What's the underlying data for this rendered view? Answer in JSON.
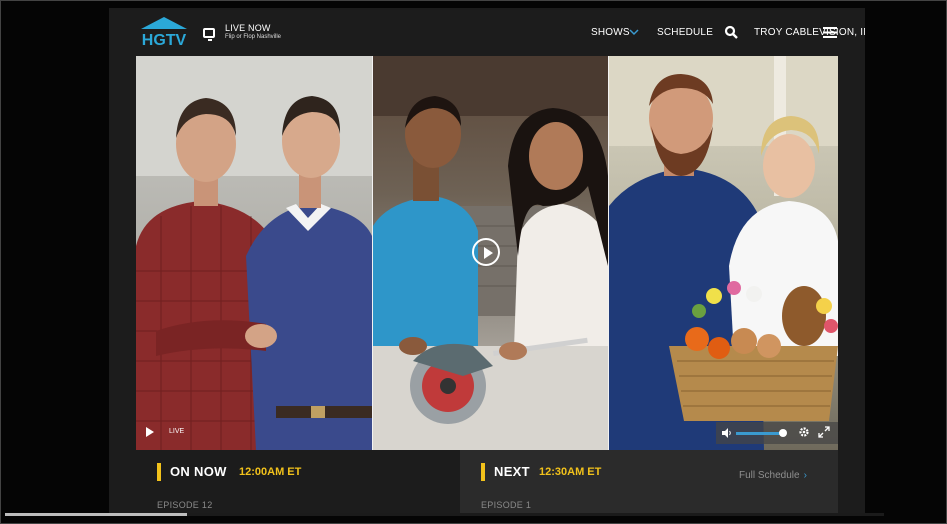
{
  "header": {
    "brand": "HGTV",
    "live_label": "LIVE NOW",
    "live_show": "Flip or Flop Nashville",
    "nav": {
      "shows": "SHOWS",
      "schedule": "SCHEDULE",
      "provider": "TROY CABLEVISION, INC."
    }
  },
  "player": {
    "live_label": "LIVE",
    "volume_level": 0.9
  },
  "on_now": {
    "label": "ON NOW",
    "time": "12:00AM ET",
    "episode": "EPISODE 12"
  },
  "next": {
    "label": "NEXT",
    "time": "12:30AM ET",
    "episode": "EPISODE 1",
    "full_schedule": "Full Schedule"
  },
  "colors": {
    "accent": "#f2c21b",
    "brand": "#2ba8d8",
    "link": "#3a9ad0",
    "background": "#1c1c1c"
  }
}
